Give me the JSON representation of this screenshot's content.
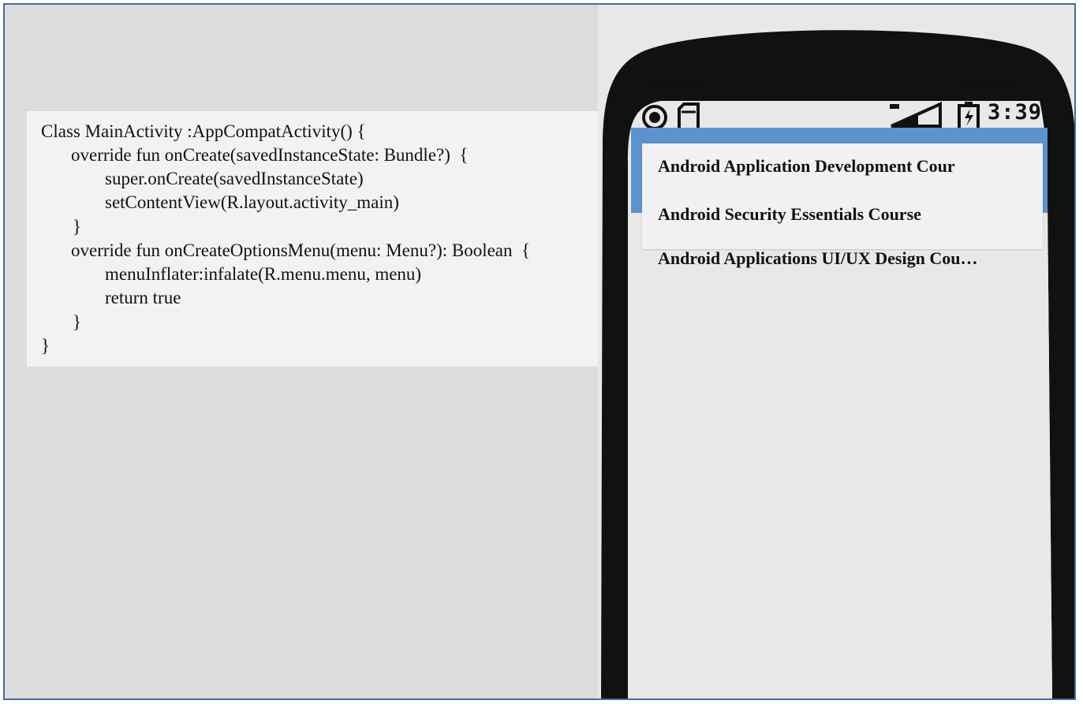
{
  "code": {
    "lines": [
      "Class MainActivity :AppCompatActivity() {",
      "override fun onCreate(savedInstanceState: Bundle?)  {",
      "super.onCreate(savedInstanceState)",
      "setContentView(R.layout.activity_main)",
      "}",
      "override fun onCreateOptionsMenu(menu: Menu?): Boolean  {",
      "menuInflater:infalate(R.menu.menu, menu)",
      "return true",
      "}",
      "}"
    ]
  },
  "phone": {
    "status_bar": {
      "time": "3:39",
      "left_icons": [
        "circle-dot-icon",
        "sd-card-icon"
      ],
      "right_icons": [
        "signal-icon",
        "battery-charging-icon"
      ]
    },
    "colors": {
      "action_bar": "#5b93cf",
      "menu_background": "#f1f1f1",
      "phone_body": "#111111"
    },
    "menu": {
      "items": [
        "Android Application Development Cour",
        "Android Security Essentials Course"
      ]
    },
    "list": {
      "items": [
        "Android Applications UI/UX Design Cou…"
      ]
    }
  }
}
